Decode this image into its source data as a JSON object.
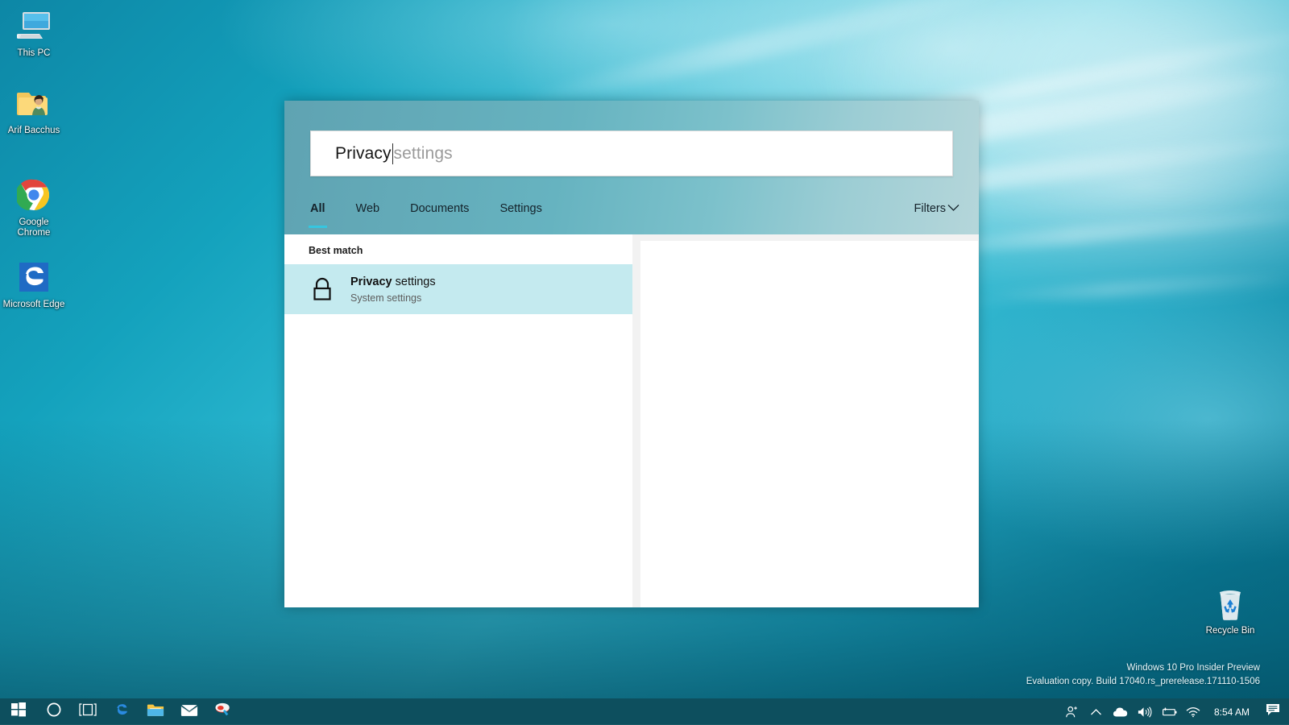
{
  "desktop": {
    "icons": [
      {
        "name": "this-pc",
        "label": "This PC",
        "icon": "computer-icon"
      },
      {
        "name": "user-folder",
        "label": "Arif Bacchus",
        "icon": "user-folder-icon"
      },
      {
        "name": "google-chrome",
        "label": "Google Chrome",
        "icon": "chrome-icon"
      },
      {
        "name": "microsoft-edge",
        "label": "Microsoft Edge",
        "icon": "edge-icon"
      },
      {
        "name": "recycle-bin",
        "label": "Recycle Bin",
        "icon": "recycle-bin-icon"
      }
    ]
  },
  "search_panel": {
    "input": {
      "typed": "Privacy",
      "suggestion": " settings",
      "full_value": "Privacy settings"
    },
    "tabs": [
      {
        "label": "All",
        "active": true
      },
      {
        "label": "Web",
        "active": false
      },
      {
        "label": "Documents",
        "active": false
      },
      {
        "label": "Settings",
        "active": false
      }
    ],
    "filters": {
      "label": "Filters",
      "icon": "chevron-down-icon"
    },
    "results": {
      "section_header": "Best match",
      "items": [
        {
          "icon": "lock-icon",
          "title_bold": "Privacy",
          "title_rest": " settings",
          "subtitle": "System settings",
          "selected": true
        }
      ]
    }
  },
  "taskbar": {
    "buttons": [
      {
        "name": "start-button",
        "icon": "windows-logo-icon"
      },
      {
        "name": "cortana-button",
        "icon": "cortana-circle-icon"
      },
      {
        "name": "task-view-button",
        "icon": "task-view-icon"
      },
      {
        "name": "edge-taskbar",
        "icon": "edge-icon"
      },
      {
        "name": "file-explorer",
        "icon": "folder-icon"
      },
      {
        "name": "mail-app",
        "icon": "mail-envelope-icon"
      },
      {
        "name": "paint-3d",
        "icon": "paint-3d-icon"
      }
    ],
    "tray": [
      {
        "name": "people-icon",
        "icon": "people-icon"
      },
      {
        "name": "show-hidden-icons",
        "icon": "chevron-up-icon"
      },
      {
        "name": "onedrive-icon",
        "icon": "cloud-icon"
      },
      {
        "name": "volume-icon",
        "icon": "speaker-icon"
      },
      {
        "name": "battery-icon",
        "icon": "battery-icon"
      },
      {
        "name": "network-icon",
        "icon": "wifi-icon"
      }
    ],
    "clock": "8:54 AM",
    "action_center": {
      "name": "action-center-button",
      "icon": "speech-bubble-icon"
    }
  },
  "watermark": {
    "line1": "Windows 10 Pro Insider Preview",
    "line2": "Evaluation copy. Build 17040.rs_prerelease.171110-1506"
  },
  "colors": {
    "accent": "#35c6e0",
    "result_highlight": "#c4eaef",
    "taskbar": "#0d4f5e",
    "panel_header_start": "#5fa3b2",
    "panel_header_end": "#b5d6da"
  }
}
